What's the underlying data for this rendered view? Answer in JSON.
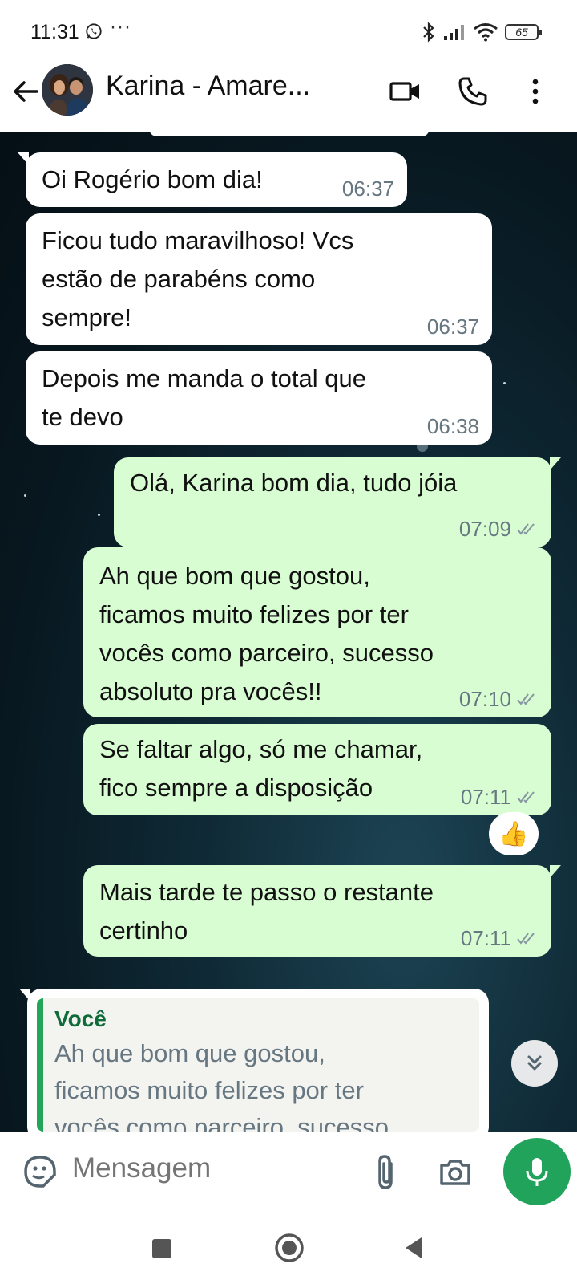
{
  "status_bar": {
    "time": "11:31",
    "dots": "···",
    "battery": "65"
  },
  "header": {
    "title": "Karina - Amare..."
  },
  "messages": [
    {
      "dir": "in",
      "text": "Oi Rogério bom dia!",
      "time": "06:37"
    },
    {
      "dir": "in",
      "text": "Ficou tudo maravilhoso! Vcs\nestão de parabéns como\nsempre!",
      "time": "06:37"
    },
    {
      "dir": "in",
      "text": "Depois me manda o total que\nte devo",
      "time": "06:38"
    },
    {
      "dir": "out",
      "text": "Olá, Karina bom dia, tudo jóia",
      "time": "07:09"
    },
    {
      "dir": "out",
      "text": "Ah que bom que gostou,\nficamos muito felizes por ter\nvocês como parceiro, sucesso\nabsoluto pra vocês!!",
      "time": "07:10"
    },
    {
      "dir": "out",
      "text": "Se faltar algo, só me chamar,\nfico sempre a disposição",
      "time": "07:11"
    },
    {
      "dir": "out",
      "text": "Mais tarde te passo o restante\ncertinho",
      "time": "07:11"
    }
  ],
  "reaction": "👍",
  "quoted": {
    "author": "Você",
    "text": "Ah que bom que gostou,\nficamos muito felizes por ter\nvocês como parceiro, sucesso"
  },
  "input": {
    "placeholder": "Mensagem"
  },
  "colors": {
    "out_bubble": "#d9fdd3",
    "in_bubble": "#ffffff",
    "accent_green": "#21a35b",
    "meta_gray": "#667781"
  },
  "icons": [
    "whatsapp-icon",
    "bluetooth-icon",
    "signal-icon",
    "wifi-icon",
    "battery-icon",
    "back-arrow-icon",
    "video-call-icon",
    "phone-icon",
    "more-vert-icon",
    "double-check-icon",
    "thumbs-up-reaction",
    "scroll-down-icon",
    "sticker-emoji-icon",
    "attach-clip-icon",
    "camera-icon",
    "mic-icon",
    "nav-recents-icon",
    "nav-home-icon",
    "nav-back-icon"
  ]
}
